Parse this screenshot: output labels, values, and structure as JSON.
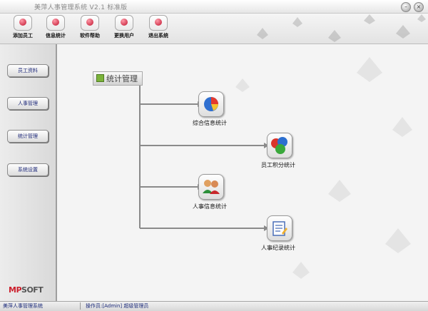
{
  "window": {
    "title": "美萍人事管理系统 V2.1 标准版"
  },
  "toolbar": {
    "buttons": [
      {
        "label": "添加员工",
        "icon": "add-employee-icon"
      },
      {
        "label": "信息统计",
        "icon": "statistics-icon"
      },
      {
        "label": "软件帮助",
        "icon": "help-icon"
      },
      {
        "label": "更换用户",
        "icon": "switch-user-icon"
      },
      {
        "label": "退出系统",
        "icon": "exit-icon"
      }
    ]
  },
  "sidebar": {
    "items": [
      {
        "label": "员工资料"
      },
      {
        "label": "人事管理"
      },
      {
        "label": "统计管理"
      },
      {
        "label": "系统设置"
      }
    ],
    "logo_left": "MP",
    "logo_right": "SOFT"
  },
  "main": {
    "section_title": "统计管理",
    "items": [
      {
        "label": "综合信息统计",
        "icon": "pie-chart-icon"
      },
      {
        "label": "员工积分统计",
        "icon": "score-icon"
      },
      {
        "label": "人事信息统计",
        "icon": "people-icon"
      },
      {
        "label": "人事纪录统计",
        "icon": "record-icon"
      }
    ]
  },
  "statusbar": {
    "left": "美萍人事管理系统",
    "right": "操作员:[Admin] 超级管理员"
  },
  "colors": {
    "accent": "#cc1f2c",
    "nav_text": "#1f2a7a",
    "connector": "#8a8a8a"
  }
}
